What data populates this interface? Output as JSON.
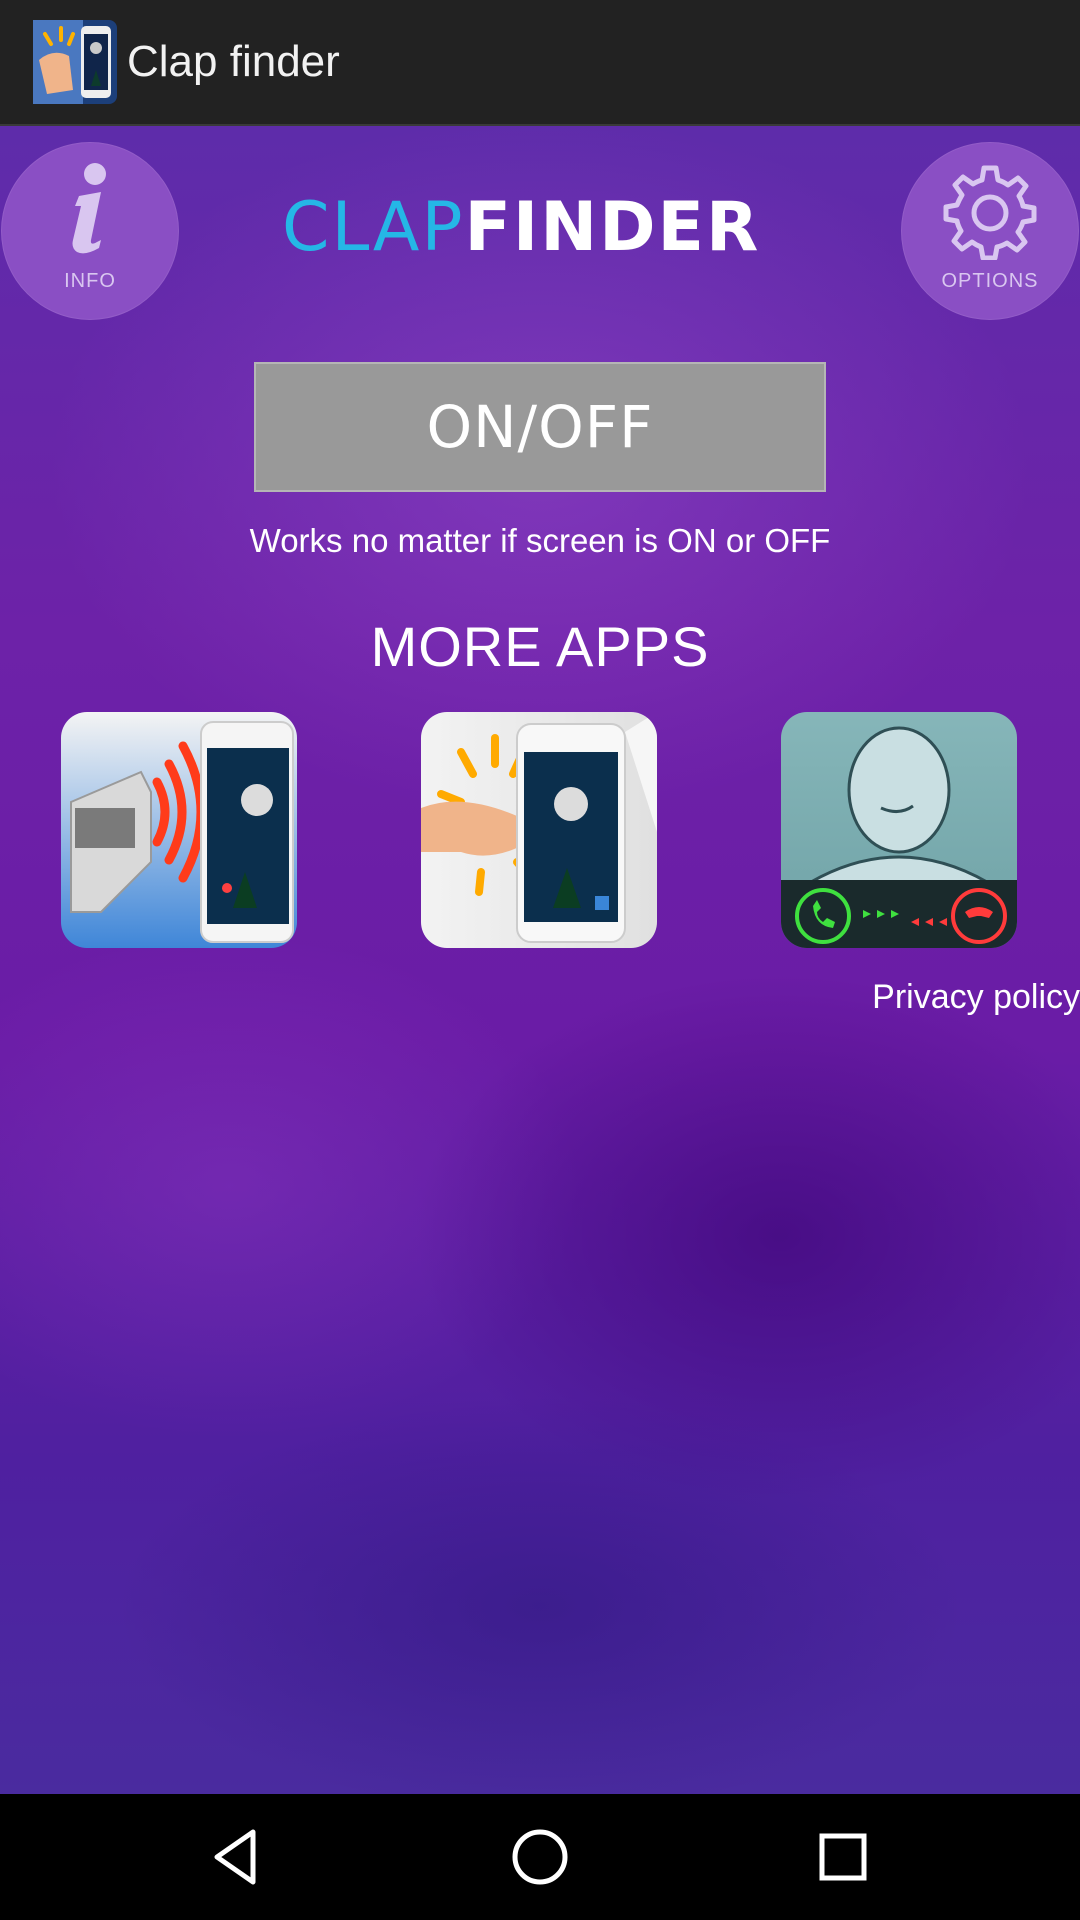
{
  "action_bar": {
    "title": "Clap finder",
    "icon": "clap-finder-app-icon"
  },
  "header": {
    "info_label": "INFO",
    "info_icon": "info-icon",
    "logo_part1": "CLAP",
    "logo_part2": "FINDER",
    "options_label": "OPTIONS",
    "options_icon": "gear-icon"
  },
  "main": {
    "onoff_label": "ON/OFF",
    "description": "Works no matter if screen is ON or OFF",
    "more_apps_title": "MORE APPS",
    "more_apps": [
      {
        "icon": "whistle-phone-finder-icon"
      },
      {
        "icon": "clap-phone-finder-icon"
      },
      {
        "icon": "caller-name-announcer-icon"
      }
    ],
    "privacy_label": "Privacy policy"
  },
  "nav_bar": {
    "back_icon": "back-icon",
    "home_icon": "home-icon",
    "recents_icon": "recents-icon"
  },
  "colors": {
    "action_bar": "#222222",
    "purple_bg": "#6a1ca6",
    "circle_button": "#8a4fc4",
    "logo_accent": "#25b7e6",
    "onoff_bg": "#999999"
  }
}
